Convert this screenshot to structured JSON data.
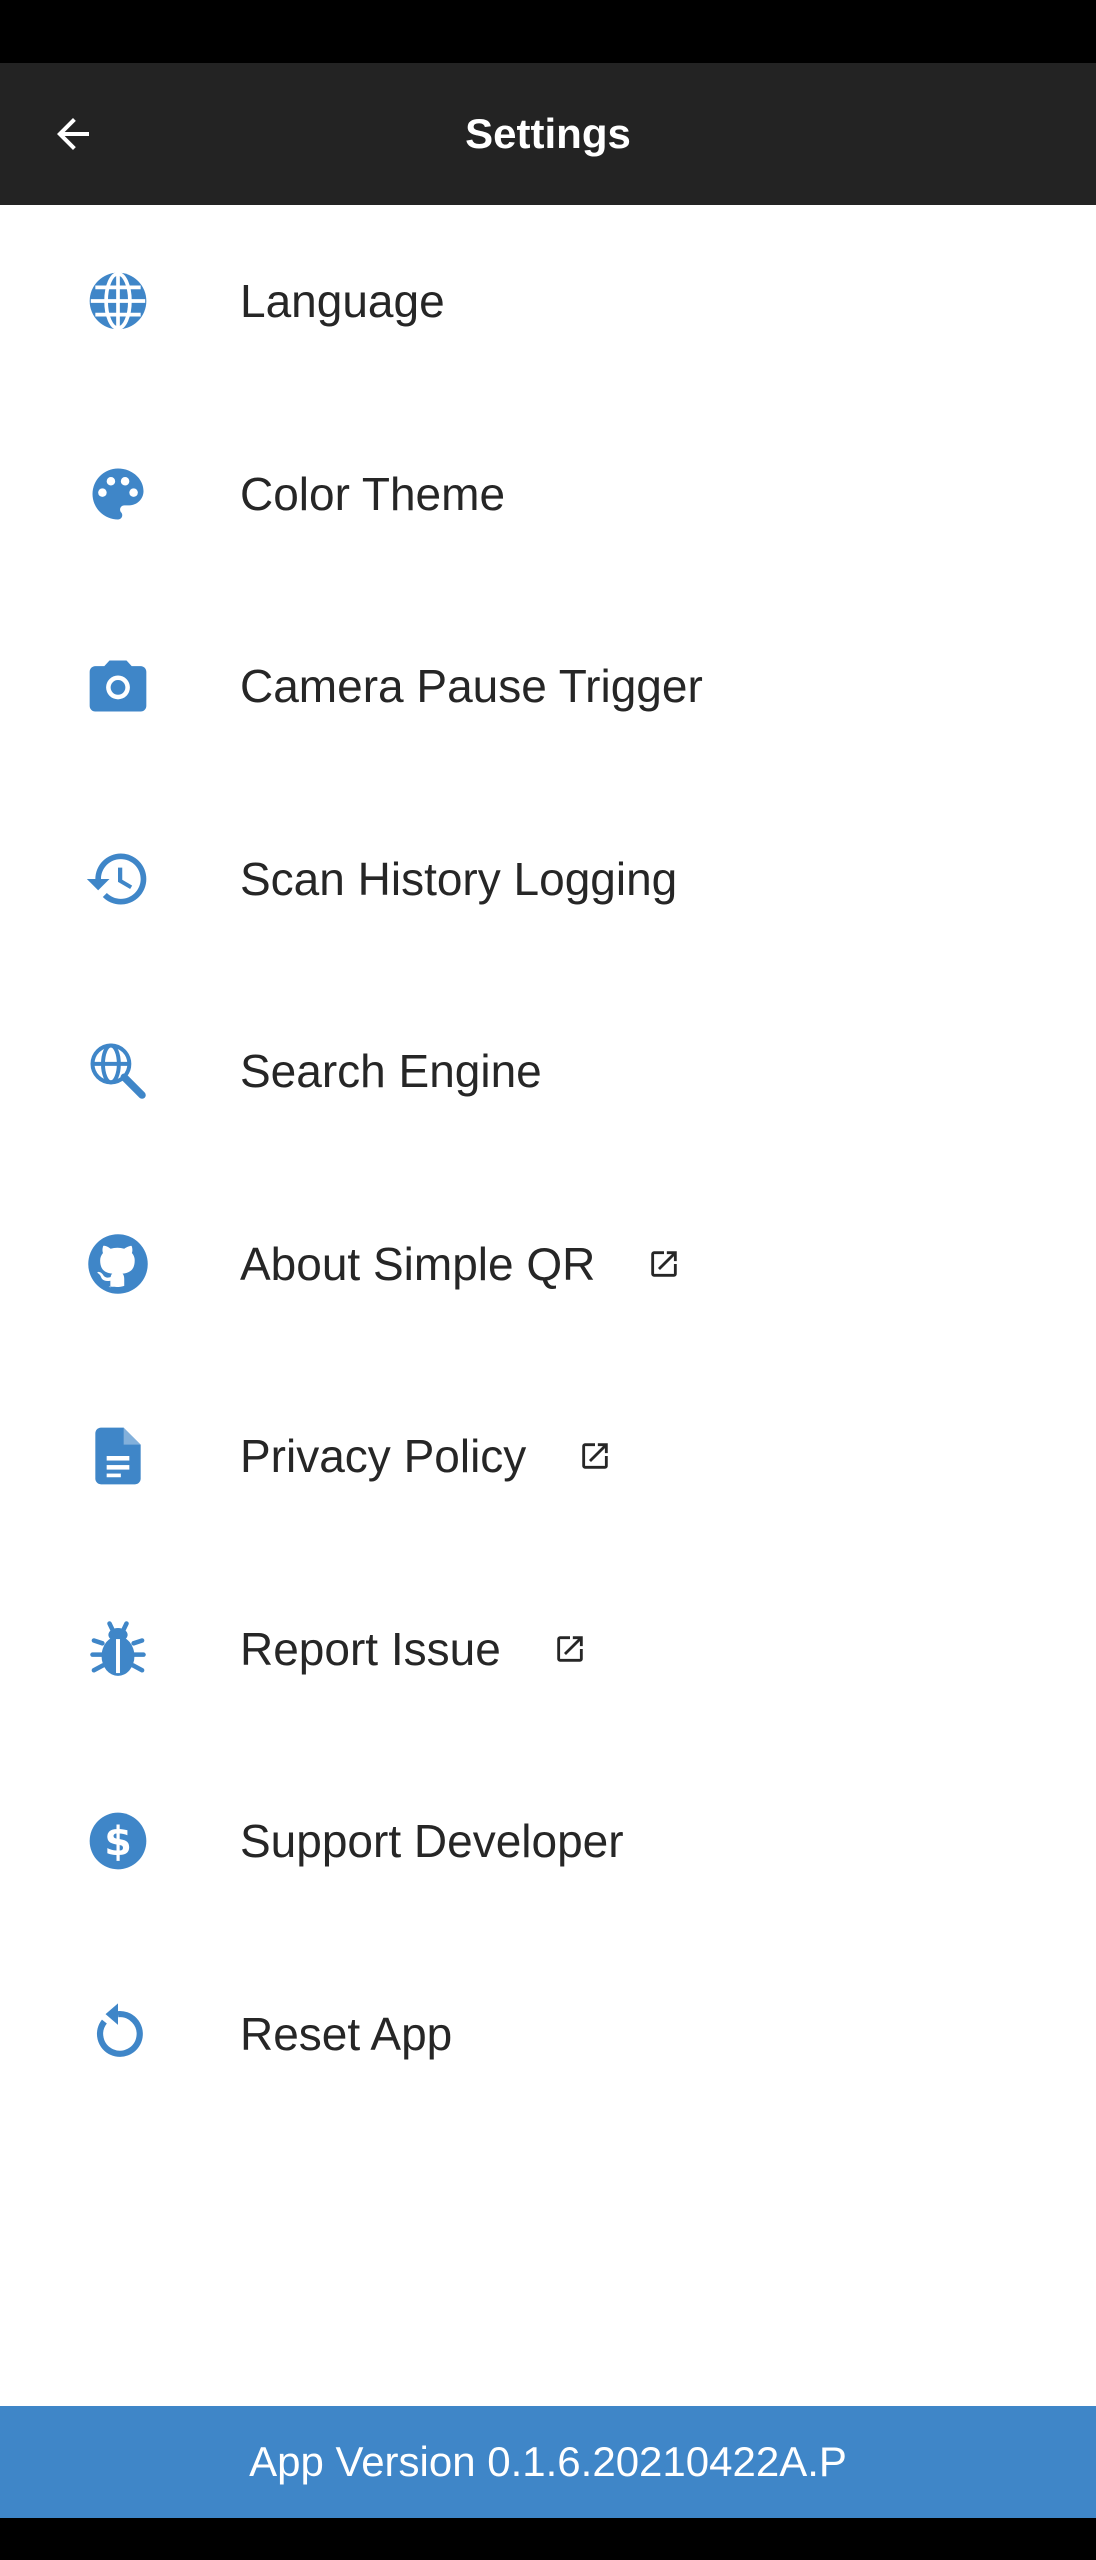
{
  "theme": {
    "accent": "#3f86c8",
    "app_bar": "#232323",
    "text": "#262626"
  },
  "header": {
    "title": "Settings",
    "back_icon": "arrow-left-icon"
  },
  "settings": {
    "items": [
      {
        "label": "Language",
        "icon": "globe-icon",
        "external": false
      },
      {
        "label": "Color Theme",
        "icon": "palette-icon",
        "external": false
      },
      {
        "label": "Camera Pause Trigger",
        "icon": "camera-icon",
        "external": false
      },
      {
        "label": "Scan History Logging",
        "icon": "history-icon",
        "external": false
      },
      {
        "label": "Search Engine",
        "icon": "search-web-icon",
        "external": false
      },
      {
        "label": "About Simple QR",
        "icon": "github-icon",
        "external": true
      },
      {
        "label": "Privacy Policy",
        "icon": "document-icon",
        "external": true
      },
      {
        "label": "Report Issue",
        "icon": "bug-icon",
        "external": true
      },
      {
        "label": "Support Developer",
        "icon": "dollar-icon",
        "external": false
      },
      {
        "label": "Reset App",
        "icon": "reset-icon",
        "external": false
      }
    ],
    "external_link_icon": "open-in-new-icon"
  },
  "footer": {
    "version_text": "App Version 0.1.6.20210422A.P"
  }
}
